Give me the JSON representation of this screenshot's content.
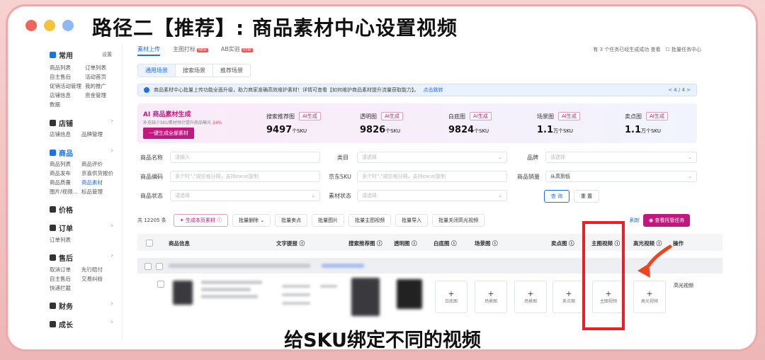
{
  "slide": {
    "title": "路径二【推荐】: 商品素材中心设置视频",
    "caption": "给SKU绑定不同的视频",
    "dot_colors": [
      "#f0645d",
      "#f5c33b",
      "#8fb8f5"
    ]
  },
  "sidebar": {
    "settings": "设置",
    "sections": [
      {
        "label": "常用",
        "links": [
          "商品列表",
          "订单列表",
          "自主售后",
          "活动首页",
          "促销活动管理",
          "我的推广",
          "店铺信息",
          "资金管理",
          "数据"
        ]
      },
      {
        "label": "店铺",
        "links": [
          "店铺信息",
          "品牌管理"
        ]
      },
      {
        "label": "商品",
        "links": [
          "商品列表",
          "商品评价",
          "商品发布",
          "京喜供货报价",
          "商品质量",
          "商品素材",
          "图片/视频...",
          "标品管理"
        ]
      },
      {
        "label": "价格",
        "links": []
      },
      {
        "label": "订单",
        "links": [
          "订单列表"
        ]
      },
      {
        "label": "售后",
        "links": [
          "取消订单",
          "先行赔付",
          "自主售后",
          "交易纠纷",
          "快递拦截"
        ]
      },
      {
        "label": "财务",
        "links": []
      },
      {
        "label": "成长",
        "links": []
      }
    ]
  },
  "main": {
    "tabs": [
      "素材上传",
      "主图打标",
      "AB实验"
    ],
    "top_right": "有 3 个任务已经生成成功 查看",
    "batch_task": "批量任务中心",
    "sub_tabs": [
      "通用场景",
      "搜索场景",
      "推荐场景"
    ],
    "notice": "商品素材中心批量上传功能全面升级，助力商家准确高效维护素材！详情可查看【如何维护商品素材提升流量获取能力】。",
    "notice_link": "点击跳转",
    "notice_page": "< 4 / 4 >",
    "ai": {
      "title": "AI 商品素材生成",
      "subtitle": "补充缺少SKU素材预计提升商品曝光",
      "pct": "24%",
      "button": "一键生成全部素材",
      "ai_tag": "AI生成",
      "stats": [
        {
          "label": "搜索推荐图",
          "value": "9497",
          "unit": "个SKU"
        },
        {
          "label": "透明图",
          "value": "9826",
          "unit": "个SKU"
        },
        {
          "label": "白底图",
          "value": "9824",
          "unit": "个SKU"
        },
        {
          "label": "场景图",
          "value": "1.1",
          "unit": "万个SKU"
        },
        {
          "label": "卖点图",
          "value": "1.1",
          "unit": "万个SKU"
        }
      ]
    },
    "filters": {
      "name_label": "商品名称",
      "name_ph": "请输入",
      "cat_label": "类目",
      "cat_ph": "请选择",
      "brand_label": "品牌",
      "brand_ph": "请选择",
      "code_label": "商品编码",
      "code_ph": "多个时\",\"或空格分隔，支持excel复制",
      "sku_label": "京东SKU",
      "sku_ph": "多个时\",\"或空格分隔，支持excel复制",
      "sales_label": "商品销量",
      "sales_val": "从高到低",
      "status_label": "商品状态",
      "status_ph": "请选择",
      "mat_label": "素材状态",
      "mat_ph": "请选择",
      "query": "查 询",
      "reset": "重 置"
    },
    "toolbar": {
      "count": "共 12205 条",
      "buttons": [
        "生成本页素材",
        "批量删除",
        "批量卖点",
        "批量图片",
        "批量主图视频",
        "批量导入",
        "批量关闭高光视频"
      ],
      "refresh": "刷新",
      "trust": "查看托管任务"
    },
    "columns": [
      "商品信息",
      "文字提报",
      "搜索推荐图",
      "透明图",
      "白底图",
      "场景图",
      "卖点图",
      "主图视频",
      "高光视频",
      "操作"
    ],
    "slots": [
      "白底图",
      "场景图",
      "场景图",
      "卖点图",
      "主图视频",
      "高光视频"
    ],
    "row_action": "高光视频"
  }
}
